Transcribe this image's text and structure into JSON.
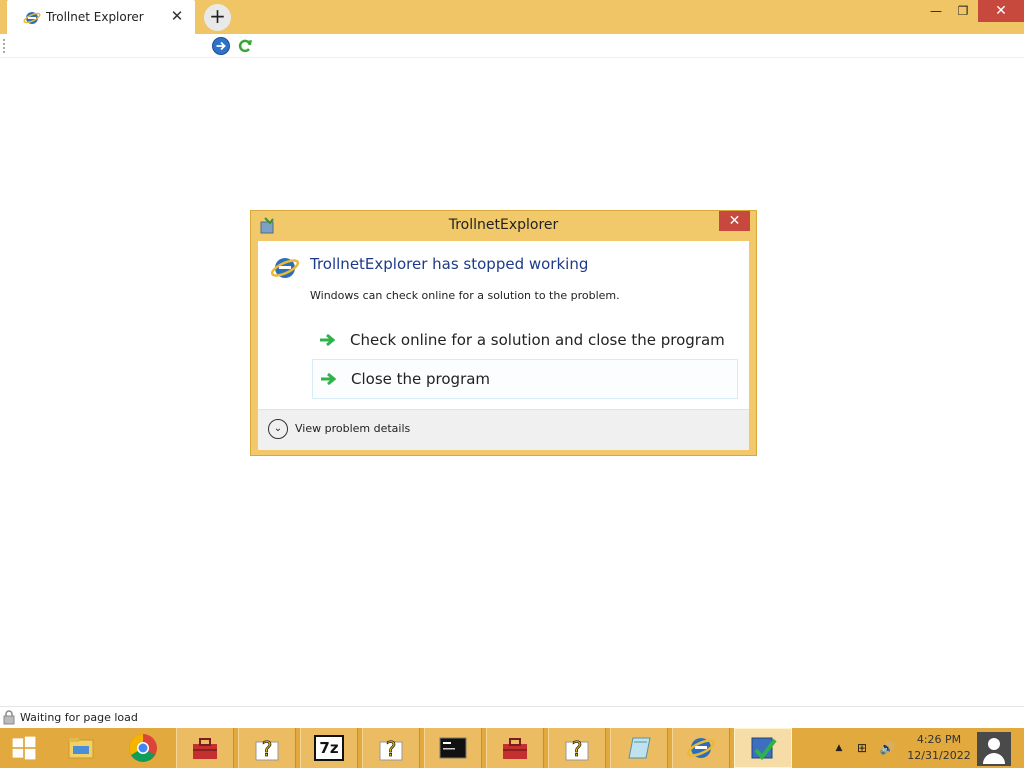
{
  "browser": {
    "tab_title": "Trollnet Explorer",
    "tab_close": "✕",
    "new_tab": "+",
    "minimize": "—",
    "restore": "❐",
    "close": "✕"
  },
  "dialog": {
    "title": "TrollnetExplorer",
    "close": "✕",
    "heading": "TrollnetExplorer has stopped working",
    "message": "Windows can check online for a solution to the problem.",
    "option_check_online": "Check online for a solution and close the program",
    "option_close": "Close the program",
    "details_link": "View problem details",
    "expander": "⌄"
  },
  "status": {
    "text": "Waiting for page load"
  },
  "taskbar": {
    "items": [
      "start-button",
      "file-explorer",
      "chrome",
      "toolbox",
      "help",
      "7zip",
      "help",
      "terminal",
      "toolbox",
      "help",
      "notepad",
      "trollnet-explorer",
      "installer"
    ],
    "sevenzip_label": "7z",
    "tray_chevron": "▲",
    "network_icon": "⊞",
    "volume_icon": "🔊",
    "time": "4:26 PM",
    "date": "12/31/2022"
  },
  "colors": {
    "titlebar": "#f0c565",
    "taskbar": "#e2a93e",
    "close_red": "#c7493e",
    "heading_blue": "#1e3a8a",
    "arrow_green": "#2eb34a"
  }
}
